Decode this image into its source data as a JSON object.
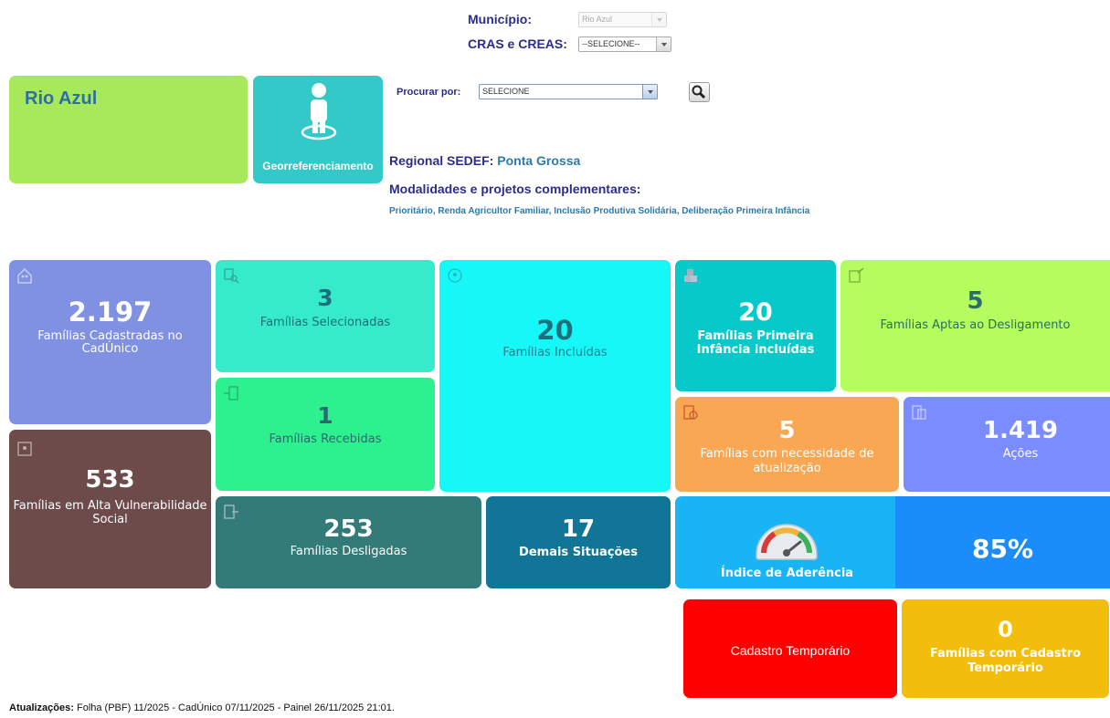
{
  "filters": {
    "municipio_label": "Município:",
    "municipio_value": "Rio Azul",
    "cras_label": "CRAS e CREAS:",
    "cras_value": "--SELECIONE--"
  },
  "city": {
    "name": "Rio Azul"
  },
  "geo": {
    "label": "Georreferenciamento"
  },
  "search": {
    "label": "Procurar por:",
    "value": "SELECIONE"
  },
  "regional": {
    "label": "Regional SEDEF:",
    "value": "Ponta Grossa"
  },
  "modalidades": {
    "label": "Modalidades e projetos complementares:",
    "value": "Prioritário, Renda Agricultor Familiar, Inclusão Produtiva Solidária, Deliberação Primeira Infância"
  },
  "tiles": {
    "cadastradas": {
      "value": "2.197",
      "label": "Famílias Cadastradas no CadÚnico",
      "color": "#7f91e0"
    },
    "vulnerabilidade": {
      "value": "533",
      "label": "Famílias em Alta Vulnerabilidade Social",
      "color": "#6d4b4b"
    },
    "selecionadas": {
      "value": "3",
      "label": "Famílias Selecionadas",
      "color": "#36ebc9"
    },
    "recebidas": {
      "value": "1",
      "label": "Famílias Recebidas",
      "color": "#2df08f"
    },
    "incluidas": {
      "value": "20",
      "label": "Famílias Incluídas",
      "color": "#16f8f8"
    },
    "desligadas": {
      "value": "253",
      "label": "Famílias Desligadas",
      "color": "#327b78"
    },
    "demais": {
      "value": "17",
      "label": "Demais Situações",
      "color": "#117597"
    },
    "primeira_infancia": {
      "value": "20",
      "label": "Famílias Primeira Infância incluídas",
      "color": "#08c9c9"
    },
    "aptas": {
      "value": "5",
      "label": "Famílias Aptas ao Desligamento",
      "color": "#b5fc5e"
    },
    "atualizacao": {
      "value": "5",
      "label": "Famílias com necessidade de atualização",
      "color": "#faa753"
    },
    "acoes": {
      "value": "1.419",
      "label": "Ações",
      "color": "#7a8cff"
    },
    "aderencia": {
      "label": "Índice de Aderência",
      "value": "85%",
      "color": "#18b4f6",
      "value_color": "#1b8dfa"
    },
    "cadastro_temp": {
      "label": "Cadastro Temporário",
      "color": "#fe0000"
    },
    "familias_temp": {
      "value": "0",
      "label": "Famílias com Cadastro Temporário",
      "color": "#f2bd0b"
    }
  },
  "footer": {
    "label": "Atualizações:",
    "text": "Folha (PBF) 11/2025 - CadÚnico 07/11/2025 - Painel 26/11/2025 21:01."
  }
}
